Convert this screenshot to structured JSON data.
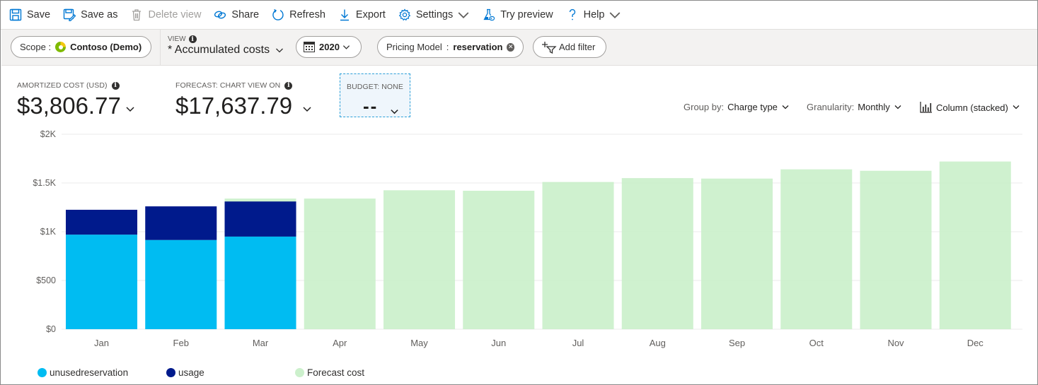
{
  "toolbar": {
    "items": [
      {
        "label": "Save",
        "icon": "save-icon"
      },
      {
        "label": "Save as",
        "icon": "save-as-icon"
      },
      {
        "label": "Delete view",
        "icon": "delete-icon",
        "disabled": true
      },
      {
        "label": "Share",
        "icon": "share-link-icon"
      },
      {
        "label": "Refresh",
        "icon": "refresh-icon"
      },
      {
        "label": "Export",
        "icon": "download-icon"
      },
      {
        "label": "Settings",
        "icon": "gear-icon",
        "dropdown": true
      },
      {
        "label": "Try preview",
        "icon": "flask-icon"
      },
      {
        "label": "Help",
        "icon": "question-icon",
        "dropdown": true
      }
    ]
  },
  "filters": {
    "scope_label": "Scope :",
    "scope_value": "Contoso (Demo)",
    "view_label": "VIEW",
    "view_value": "* Accumulated costs",
    "date_value": "2020",
    "pricing_label": "Pricing Model",
    "pricing_sep": ":",
    "pricing_value": "reservation",
    "add_filter": "Add filter"
  },
  "kpis": {
    "amortized_label": "AMORTIZED COST (USD)",
    "amortized_value": "$3,806.77",
    "forecast_label": "FORECAST: CHART VIEW ON",
    "forecast_value": "$17,637.79",
    "budget_label": "BUDGET: NONE",
    "budget_value": "--"
  },
  "controls": {
    "group_by_label": "Group by:",
    "group_by_value": "Charge type",
    "granularity_label": "Granularity:",
    "granularity_value": "Monthly",
    "chart_type_value": "Column (stacked)"
  },
  "colors": {
    "unusedreservation": "#00bcf2",
    "usage": "#001a8c",
    "forecast": "#ccf0cc",
    "grid": "#ebebeb",
    "axis_text": "#605e5c"
  },
  "chart_data": {
    "type": "bar",
    "stacked": true,
    "title": "",
    "xlabel": "",
    "ylabel": "",
    "ylim": [
      0,
      2000
    ],
    "yticks": [
      0,
      500,
      1000,
      1500,
      2000
    ],
    "ytick_labels": [
      "$0",
      "$500",
      "$1K",
      "$1.5K",
      "$2K"
    ],
    "grid": true,
    "legend_position": "bottom-left",
    "categories": [
      "Jan",
      "Feb",
      "Mar",
      "Apr",
      "May",
      "Jun",
      "Jul",
      "Aug",
      "Sep",
      "Oct",
      "Nov",
      "Dec"
    ],
    "series": [
      {
        "name": "unusedreservation",
        "values": [
          970,
          915,
          950,
          null,
          null,
          null,
          null,
          null,
          null,
          null,
          null,
          null
        ]
      },
      {
        "name": "usage",
        "values": [
          255,
          345,
          360,
          null,
          null,
          null,
          null,
          null,
          null,
          null,
          null,
          null
        ]
      },
      {
        "name": "Forecast cost",
        "values": [
          null,
          null,
          1340,
          1340,
          1425,
          1420,
          1510,
          1550,
          1545,
          1640,
          1625,
          1720
        ]
      }
    ]
  }
}
